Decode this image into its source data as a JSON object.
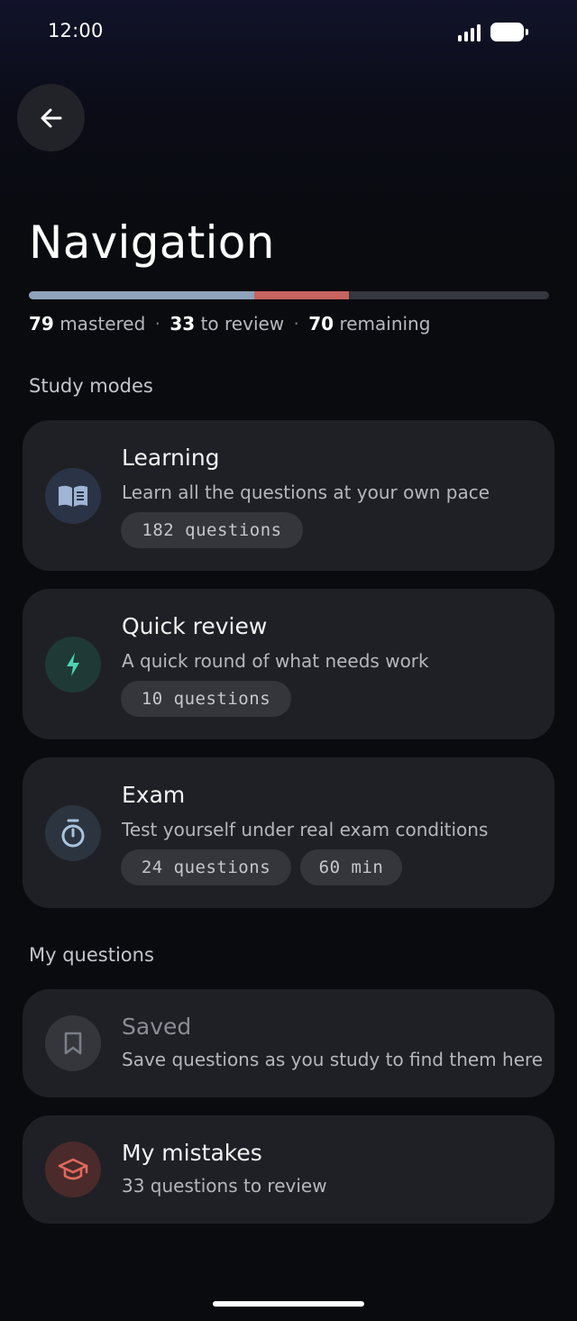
{
  "status_bar": {
    "time": "12:00"
  },
  "header": {
    "title": "Navigation"
  },
  "progress": {
    "mastered": 79,
    "to_review": 33,
    "remaining": 70,
    "total": 182,
    "mastered_count": "79",
    "mastered_label": "mastered",
    "review_count": "33",
    "review_label": "to review",
    "remaining_count": "70",
    "remaining_label": "remaining",
    "separator": "·",
    "colors": {
      "mastered": "#8ea3bb",
      "to_review": "#c7645f",
      "remaining": "#35373e"
    }
  },
  "study_modes": {
    "label": "Study modes",
    "items": [
      {
        "title": "Learning",
        "subtitle": "Learn all the questions at your own pace",
        "icon": "book-icon",
        "chips": [
          "182 questions"
        ]
      },
      {
        "title": "Quick review",
        "subtitle": "A quick round of what needs work",
        "icon": "lightning-icon",
        "chips": [
          "10 questions"
        ]
      },
      {
        "title": "Exam",
        "subtitle": "Test yourself under real exam conditions",
        "icon": "stopwatch-icon",
        "chips": [
          "24 questions",
          "60 min"
        ]
      }
    ]
  },
  "my_questions": {
    "label": "My questions",
    "items": [
      {
        "title": "Saved",
        "subtitle": "Save questions as you study to find them here",
        "icon": "bookmark-icon"
      },
      {
        "title": "My mistakes",
        "subtitle": "33 questions to review",
        "icon": "graduation-cap-icon"
      }
    ]
  },
  "colors": {
    "background": "#0a0b0f",
    "card": "#1f2025",
    "learning_accent": "#9fb4d6",
    "quick_review_accent": "#4fd1b0",
    "exam_accent": "#a9c3df",
    "mistakes_accent": "#e06a5e"
  }
}
